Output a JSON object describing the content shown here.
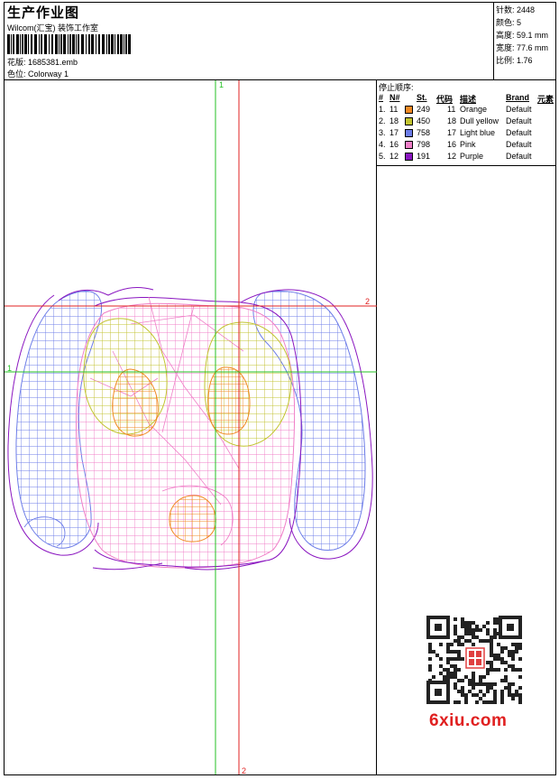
{
  "header": {
    "title": "生产作业图",
    "company": "Wilcom(汇宝) 装饰工作室",
    "design_label": "花版: 1685381.emb",
    "colorway_label": "色位: Colorway 1"
  },
  "stats": {
    "stitches": "针数: 2448",
    "colors": "颜色: 5",
    "height": "高度: 59.1 mm",
    "width": "宽度: 77.6 mm",
    "scale": "比例: 1.76"
  },
  "legend": {
    "title": "停止顺序:",
    "columns": [
      "#",
      "N#",
      "St.",
      "代码",
      "描述",
      "Brand",
      "元素"
    ],
    "rows": [
      {
        "idx": "1.",
        "n": "11",
        "st": "249",
        "code": "11",
        "desc": "Orange",
        "brand": "Default",
        "color": "#f08a24"
      },
      {
        "idx": "2.",
        "n": "18",
        "st": "450",
        "code": "18",
        "desc": "Dull yellow",
        "brand": "Default",
        "color": "#c2c430"
      },
      {
        "idx": "3.",
        "n": "17",
        "st": "758",
        "code": "17",
        "desc": "Light blue",
        "brand": "Default",
        "color": "#6d7de8"
      },
      {
        "idx": "4.",
        "n": "16",
        "st": "798",
        "code": "16",
        "desc": "Pink",
        "brand": "Default",
        "color": "#f07fc8"
      },
      {
        "idx": "5.",
        "n": "12",
        "st": "191",
        "code": "12",
        "desc": "Purple",
        "brand": "Default",
        "color": "#8a16c0"
      }
    ]
  },
  "axes": {
    "v1": "1",
    "v2": "2",
    "h1": "1",
    "h2": "2",
    "green": "#23c023",
    "red": "#e02020"
  },
  "watermark": "6xiu.com"
}
